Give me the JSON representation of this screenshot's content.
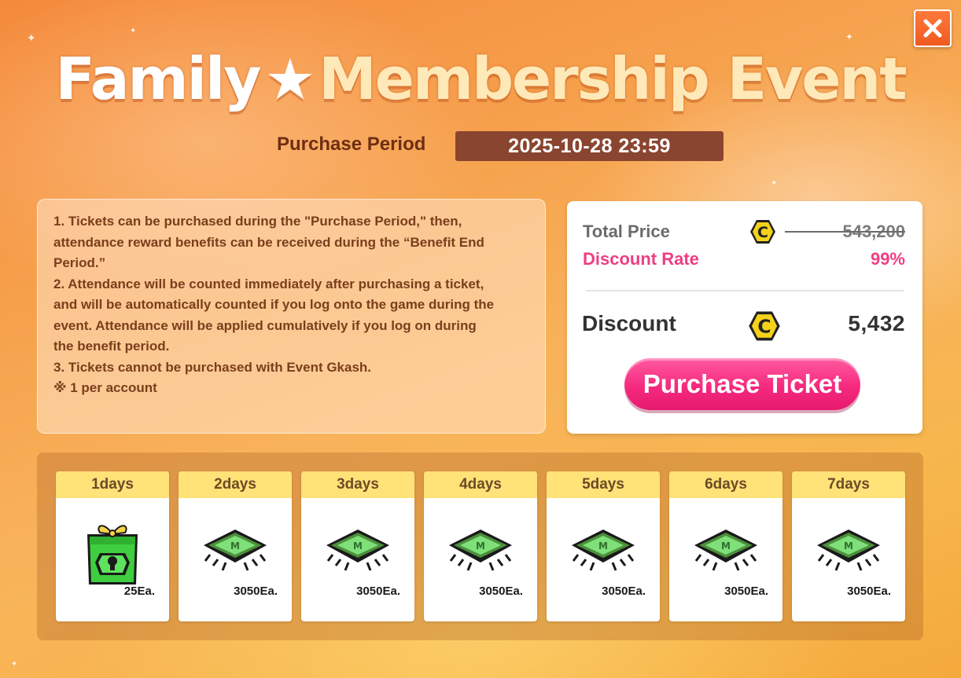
{
  "header": {
    "title_part1": "Family",
    "title_part2": "Membership Event",
    "close_icon": "close-icon"
  },
  "period": {
    "label": "Purchase Period",
    "value": "2025-10-28 23:59"
  },
  "info": {
    "lines": [
      "1. Tickets can be purchased during the \"Purchase Period,\" then,",
      "attendance reward benefits can be received during the “Benefit End",
      "Period.”",
      "2. Attendance will be counted immediately after purchasing a ticket,",
      "and will be automatically counted if you log onto the game during the",
      "event. Attendance will be applied cumulatively if you log on during",
      "the benefit period.",
      "3. Tickets cannot be purchased with Event Gkash.",
      "※ 1 per account"
    ]
  },
  "price": {
    "total_label": "Total Price",
    "total_value": "543,200",
    "rate_label": "Discount Rate",
    "rate_value": "99%",
    "discount_label": "Discount",
    "discount_value": "5,432",
    "currency_icon": "coin-icon",
    "purchase_label": "Purchase Ticket",
    "colors": {
      "accent": "#ee3e82",
      "button": "#f52a7e"
    }
  },
  "rewards": [
    {
      "day": "1days",
      "qty": "25Ea.",
      "icon": "gift-box-icon"
    },
    {
      "day": "2days",
      "qty": "3050Ea.",
      "icon": "chip-icon"
    },
    {
      "day": "3days",
      "qty": "3050Ea.",
      "icon": "chip-icon"
    },
    {
      "day": "4days",
      "qty": "3050Ea.",
      "icon": "chip-icon"
    },
    {
      "day": "5days",
      "qty": "3050Ea.",
      "icon": "chip-icon"
    },
    {
      "day": "6days",
      "qty": "3050Ea.",
      "icon": "chip-icon"
    },
    {
      "day": "7days",
      "qty": "3050Ea.",
      "icon": "chip-icon"
    }
  ]
}
